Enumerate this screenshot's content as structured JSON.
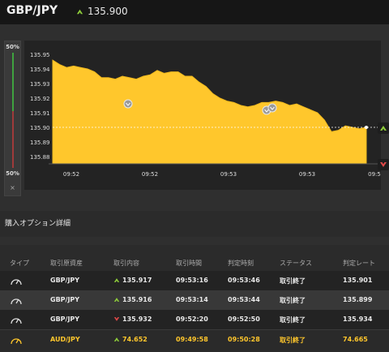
{
  "header": {
    "pair": "GBP/JPY",
    "price": "135.900",
    "price_direction": "up",
    "up_color": "#8fce3a"
  },
  "meter": {
    "top_label": "50%",
    "bottom_label": "50%",
    "close": "×",
    "up_share": 0.5
  },
  "chart_data": {
    "type": "area",
    "title": "",
    "xlabel": "",
    "ylabel": "",
    "ylim": [
      135.875,
      135.955
    ],
    "y_ticks": [
      "135.95",
      "135.94",
      "135.93",
      "135.92",
      "135.91",
      "135.90",
      "135.89",
      "135.88"
    ],
    "x_ticks": [
      "09:52",
      "09:52",
      "09:53",
      "09:53",
      "09:5"
    ],
    "series": [
      {
        "values": [
          135.946,
          135.943,
          135.941,
          135.942,
          135.941,
          135.94,
          135.938,
          135.934,
          135.934,
          135.933,
          135.935,
          135.934,
          135.933,
          135.935,
          135.936,
          135.939,
          135.937,
          135.938,
          135.938,
          135.935,
          135.935,
          135.931,
          135.928,
          135.923,
          135.92,
          135.918,
          135.917,
          135.915,
          135.914,
          135.915,
          135.917,
          135.917,
          135.918,
          135.917,
          135.915,
          135.916,
          135.914,
          135.912,
          135.91,
          135.905,
          135.897,
          135.898,
          135.901,
          135.9,
          135.899,
          135.9
        ]
      }
    ],
    "current_price": 135.9,
    "fill_color": "#ffc72c",
    "grid": false
  },
  "details": {
    "title": "購入オプション詳細",
    "columns": [
      "タイプ",
      "取引原資産",
      "取引内容",
      "取引時間",
      "判定時刻",
      "ステータス",
      "判定レート"
    ],
    "rows": [
      {
        "asset": "GBP/JPY",
        "direction": "up",
        "rate": "135.917",
        "trade_time": "09:53:16",
        "judge_time": "09:53:46",
        "status": "取引終了",
        "judge_rate": "135.901",
        "highlight": false
      },
      {
        "asset": "GBP/JPY",
        "direction": "up",
        "rate": "135.916",
        "trade_time": "09:53:14",
        "judge_time": "09:53:44",
        "status": "取引終了",
        "judge_rate": "135.899",
        "highlight": false
      },
      {
        "asset": "GBP/JPY",
        "direction": "down",
        "rate": "135.932",
        "trade_time": "09:52:20",
        "judge_time": "09:52:50",
        "status": "取引終了",
        "judge_rate": "135.934",
        "highlight": false
      },
      {
        "asset": "AUD/JPY",
        "direction": "up",
        "rate": "74.652",
        "trade_time": "09:49:58",
        "judge_time": "09:50:28",
        "status": "取引終了",
        "judge_rate": "74.665",
        "highlight": true
      }
    ]
  }
}
